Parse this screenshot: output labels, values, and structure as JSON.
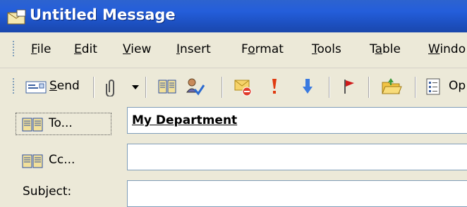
{
  "window": {
    "title": "Untitled Message"
  },
  "menu": {
    "items": [
      {
        "mnemonic": "F",
        "rest": "ile"
      },
      {
        "mnemonic": "E",
        "rest": "dit"
      },
      {
        "mnemonic": "V",
        "rest": "iew"
      },
      {
        "mnemonic": "I",
        "rest": "nsert"
      },
      {
        "pre": "F",
        "mnemonic": "o",
        "rest": "rmat"
      },
      {
        "mnemonic": "T",
        "rest": "ools"
      },
      {
        "pre": "T",
        "mnemonic": "a",
        "rest": "ble"
      },
      {
        "mnemonic": "W",
        "rest": "indo"
      }
    ]
  },
  "toolbar": {
    "send_mnemonic": "S",
    "send_rest": "end",
    "options_label": "Op"
  },
  "address": {
    "to_label": "To...",
    "cc_label": "Cc...",
    "subject_label": "Subject:",
    "to_value": "My Department",
    "cc_value": "",
    "subject_value": ""
  },
  "colors": {
    "titlebar": "#245EDB",
    "chrome": "#ECE9D8",
    "field_border": "#7f9db9"
  }
}
